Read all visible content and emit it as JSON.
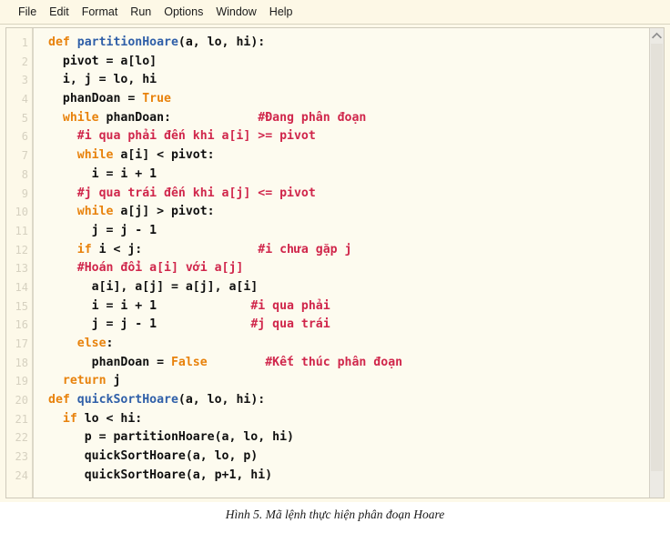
{
  "window": {
    "app": "Python IDLE Editor"
  },
  "menubar": {
    "items": [
      {
        "label": "File"
      },
      {
        "label": "Edit"
      },
      {
        "label": "Format"
      },
      {
        "label": "Run"
      },
      {
        "label": "Options"
      },
      {
        "label": "Window"
      },
      {
        "label": "Help"
      }
    ]
  },
  "editor": {
    "line_numbers": [
      "1",
      "2",
      "3",
      "4",
      "5",
      "6",
      "7",
      "8",
      "9",
      "10",
      "11",
      "12",
      "13",
      "14",
      "15",
      "16",
      "17",
      "18",
      "19",
      "20",
      "21",
      "22",
      "23",
      "24"
    ],
    "lines": [
      {
        "n": "1",
        "segments": [
          {
            "t": "def ",
            "c": "kw"
          },
          {
            "t": "partitionHoare",
            "c": "def"
          },
          {
            "t": "(a, lo, hi):",
            "c": "plain"
          }
        ]
      },
      {
        "n": "2",
        "segments": [
          {
            "t": "  pivot = a[lo]",
            "c": "plain"
          }
        ]
      },
      {
        "n": "3",
        "segments": [
          {
            "t": "  i, j = lo, hi",
            "c": "plain"
          }
        ]
      },
      {
        "n": "4",
        "segments": [
          {
            "t": "  phanDoan = ",
            "c": "plain"
          },
          {
            "t": "True",
            "c": "kw"
          }
        ]
      },
      {
        "n": "5",
        "segments": [
          {
            "t": "  ",
            "c": "plain"
          },
          {
            "t": "while",
            "c": "kw"
          },
          {
            "t": " phanDoan:            ",
            "c": "plain"
          },
          {
            "t": "#Đang phân đoạn",
            "c": "cmt"
          }
        ]
      },
      {
        "n": "6",
        "segments": [
          {
            "t": "    ",
            "c": "plain"
          },
          {
            "t": "#i qua phải đến khi a[i] >= pivot",
            "c": "cmt"
          }
        ]
      },
      {
        "n": "7",
        "segments": [
          {
            "t": "    ",
            "c": "plain"
          },
          {
            "t": "while",
            "c": "kw"
          },
          {
            "t": " a[i] < pivot:",
            "c": "plain"
          }
        ]
      },
      {
        "n": "8",
        "segments": [
          {
            "t": "      i = i + 1",
            "c": "plain"
          }
        ]
      },
      {
        "n": "9",
        "segments": [
          {
            "t": "    ",
            "c": "plain"
          },
          {
            "t": "#j qua trái đến khi a[j] <= pivot",
            "c": "cmt"
          }
        ]
      },
      {
        "n": "10",
        "segments": [
          {
            "t": "    ",
            "c": "plain"
          },
          {
            "t": "while",
            "c": "kw"
          },
          {
            "t": " a[j] > pivot:",
            "c": "plain"
          }
        ]
      },
      {
        "n": "11",
        "segments": [
          {
            "t": "      j = j - 1",
            "c": "plain"
          }
        ]
      },
      {
        "n": "12",
        "segments": [
          {
            "t": "    ",
            "c": "plain"
          },
          {
            "t": "if",
            "c": "kw"
          },
          {
            "t": " i < j:                ",
            "c": "plain"
          },
          {
            "t": "#i chưa gặp j",
            "c": "cmt"
          }
        ]
      },
      {
        "n": "13",
        "segments": [
          {
            "t": "    ",
            "c": "plain"
          },
          {
            "t": "#Hoán đổi a[i] với a[j]",
            "c": "cmt"
          }
        ]
      },
      {
        "n": "14",
        "segments": [
          {
            "t": "      a[i], a[j] = a[j], a[i]",
            "c": "plain"
          }
        ]
      },
      {
        "n": "15",
        "segments": [
          {
            "t": "      i = i + 1             ",
            "c": "plain"
          },
          {
            "t": "#i qua phải",
            "c": "cmt"
          }
        ]
      },
      {
        "n": "16",
        "segments": [
          {
            "t": "      j = j - 1             ",
            "c": "plain"
          },
          {
            "t": "#j qua trái",
            "c": "cmt"
          }
        ]
      },
      {
        "n": "17",
        "segments": [
          {
            "t": "    ",
            "c": "plain"
          },
          {
            "t": "else",
            "c": "kw"
          },
          {
            "t": ":",
            "c": "plain"
          }
        ]
      },
      {
        "n": "18",
        "segments": [
          {
            "t": "      phanDoan = ",
            "c": "plain"
          },
          {
            "t": "False",
            "c": "kw"
          },
          {
            "t": "        ",
            "c": "plain"
          },
          {
            "t": "#Kết thúc phân đoạn",
            "c": "cmt"
          }
        ]
      },
      {
        "n": "19",
        "segments": [
          {
            "t": "  ",
            "c": "plain"
          },
          {
            "t": "return",
            "c": "kw"
          },
          {
            "t": " j",
            "c": "plain"
          }
        ]
      },
      {
        "n": "20",
        "segments": [
          {
            "t": "def ",
            "c": "kw"
          },
          {
            "t": "quickSortHoare",
            "c": "def"
          },
          {
            "t": "(a, lo, hi):",
            "c": "plain"
          }
        ]
      },
      {
        "n": "21",
        "segments": [
          {
            "t": "  ",
            "c": "plain"
          },
          {
            "t": "if",
            "c": "kw"
          },
          {
            "t": " lo < hi:",
            "c": "plain"
          }
        ]
      },
      {
        "n": "22",
        "segments": [
          {
            "t": "     p = partitionHoare(a, lo, hi)",
            "c": "plain"
          }
        ]
      },
      {
        "n": "23",
        "segments": [
          {
            "t": "     quickSortHoare(a, lo, p)",
            "c": "plain"
          }
        ]
      },
      {
        "n": "24",
        "segments": [
          {
            "t": "     quickSortHoare(a, p+1, hi)",
            "c": "plain"
          }
        ]
      }
    ]
  },
  "scrollbar": {
    "up_arrow_icon": "chevron-up-icon"
  },
  "caption": {
    "text": "Hình 5. Mã lệnh thực hiện phân đoạn Hoare"
  },
  "colors": {
    "keyword": "#e8820c",
    "definition": "#2f5fa8",
    "comment": "#d0264b",
    "text": "#101010",
    "editor_bg": "#fdfbef",
    "menubar_bg": "#fdf8e6",
    "gutter_text": "#d6d1c0"
  }
}
